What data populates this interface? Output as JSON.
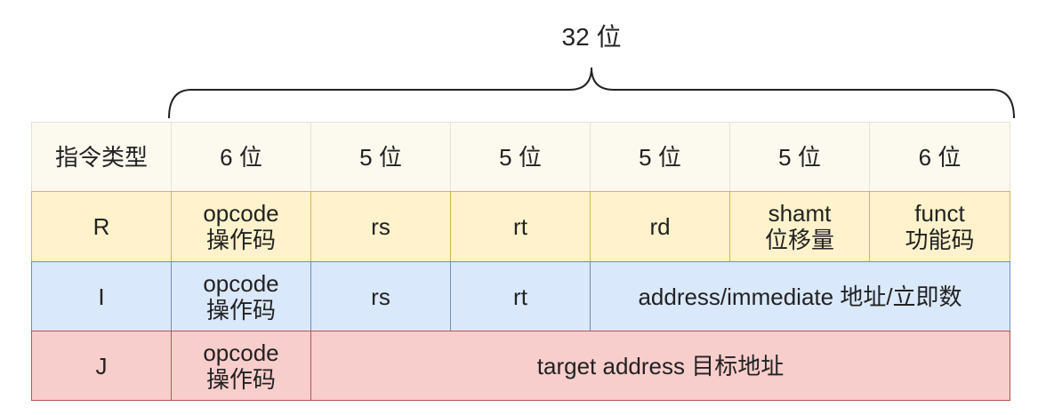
{
  "title": "32 位",
  "header": [
    "指令类型",
    "6 位",
    "5 位",
    "5 位",
    "5 位",
    "5 位",
    "6 位"
  ],
  "rows": {
    "r": [
      "R",
      "opcode\n操作码",
      "rs",
      "rt",
      "rd",
      "shamt\n位移量",
      "funct\n功能码"
    ],
    "i": [
      "I",
      "opcode\n操作码",
      "rs",
      "rt",
      "address/immediate 地址/立即数"
    ],
    "j": [
      "J",
      "opcode\n操作码",
      "target address 目标地址"
    ]
  },
  "colors": {
    "r": "#fff2cc",
    "i": "#dae8fc",
    "j": "#f8cecc",
    "header": "#fcf9ef"
  }
}
